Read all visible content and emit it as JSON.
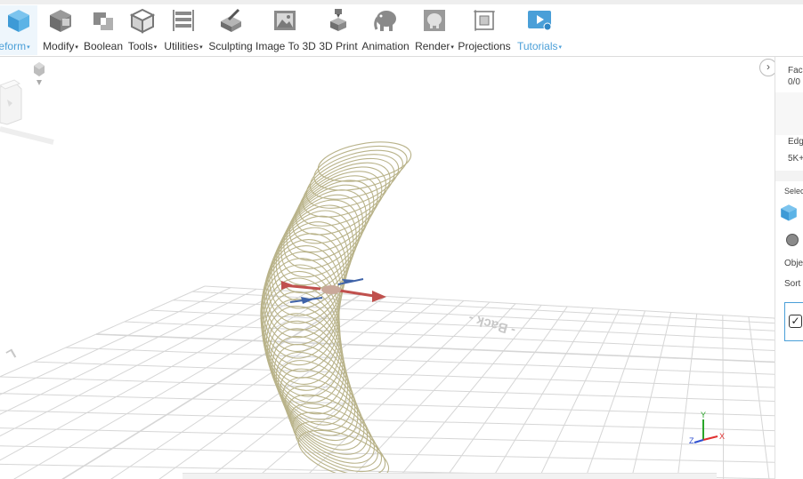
{
  "toolbar": {
    "items": [
      {
        "label": "eform",
        "icon": "freeform-cube-icon",
        "dropdown": true,
        "active": true
      },
      {
        "label": "Modify",
        "icon": "modify-icon",
        "dropdown": true
      },
      {
        "label": "Boolean",
        "icon": "boolean-icon",
        "dropdown": false
      },
      {
        "label": "Tools",
        "icon": "tools-icon",
        "dropdown": true
      },
      {
        "label": "Utilities",
        "icon": "utilities-icon",
        "dropdown": true
      },
      {
        "label": "Sculpting",
        "icon": "sculpting-icon",
        "dropdown": false
      },
      {
        "label": "Image To 3D",
        "icon": "image-to-3d-icon",
        "dropdown": false
      },
      {
        "label": "3D Print",
        "icon": "3d-print-icon",
        "dropdown": false
      },
      {
        "label": "Animation",
        "icon": "animation-elephant-icon",
        "dropdown": false
      },
      {
        "label": "Render",
        "icon": "render-icon",
        "dropdown": true
      },
      {
        "label": "Projections",
        "icon": "projections-icon",
        "dropdown": false
      },
      {
        "label": "Tutorials",
        "icon": "tutorials-play-icon",
        "dropdown": true,
        "active": true
      }
    ],
    "caret": "▾"
  },
  "panel": {
    "faces_label": "Face",
    "faces_value": "0/0",
    "edges_label": "Edg",
    "edges_value": "5K+",
    "select_label": "Selec",
    "object_label": "Obje",
    "sort_label": "Sort",
    "collapse_glyph": "›"
  },
  "viewport": {
    "ground_text_right": "- Back -",
    "ground_text_left": "L",
    "axes": {
      "x": "X",
      "y": "Y",
      "z": "Z"
    }
  },
  "colors": {
    "accent": "#4a9fd8",
    "coil": "#b9b38a",
    "grid": "#d6d6d6",
    "gizmo_red": "#c0504d",
    "gizmo_blue": "#3f63a8",
    "axis_x": "#e03030",
    "axis_y": "#2aa52a",
    "axis_z": "#3050d0"
  }
}
